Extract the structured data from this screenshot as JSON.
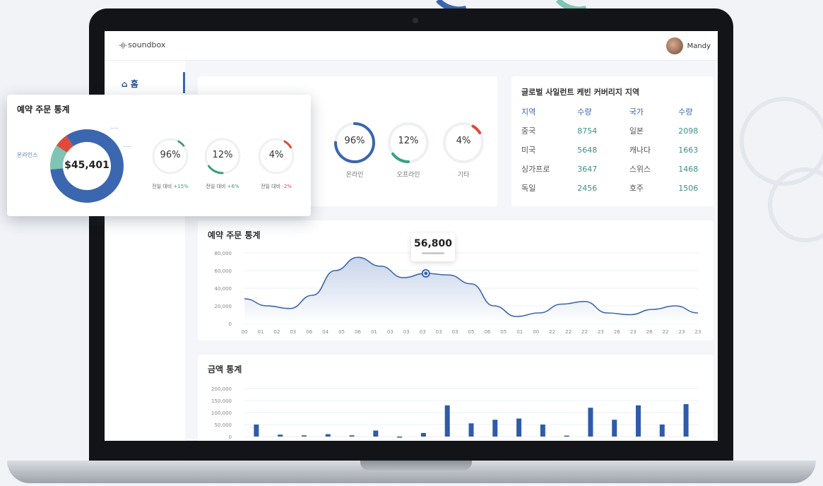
{
  "app": {
    "name": "soundbox",
    "user": "Mandy"
  },
  "sidebar": {
    "home_label": "홈"
  },
  "ring_cards": [
    {
      "value": "96%",
      "label": "온라인",
      "pct": 0.96,
      "color": "#3b65ad"
    },
    {
      "value": "12%",
      "label": "오프라인",
      "pct": 0.12,
      "color": "#3c9f86"
    },
    {
      "value": "4%",
      "label": "기타",
      "pct": 0.04,
      "color": "#e04a3a"
    }
  ],
  "coverage": {
    "title": "글로벌 사일런트 케빈 커버리지 지역",
    "headers": [
      "지역",
      "수량",
      "국가",
      "수량"
    ],
    "rows": [
      [
        "중국",
        "8754",
        "일본",
        "2098"
      ],
      [
        "미국",
        "5648",
        "캐나다",
        "1663"
      ],
      [
        "싱가프로",
        "3647",
        "스위스",
        "1468"
      ],
      [
        "독일",
        "2456",
        "호주",
        "1506"
      ]
    ]
  },
  "popup": {
    "title": "예약 주문 통계",
    "total": "$45,401",
    "left_label": "온라인스",
    "rings": [
      {
        "value": "96%",
        "caption_prefix": "전일 대비",
        "delta": "+15%",
        "pct": 0.96,
        "color": "#3c9f76"
      },
      {
        "value": "12%",
        "caption_prefix": "전일 대비",
        "delta": "+6%",
        "pct": 0.12,
        "color": "#3c9f76"
      },
      {
        "value": "4%",
        "caption_prefix": "전일 대비",
        "delta": "-2%",
        "pct": 0.04,
        "color": "#e04a3a"
      }
    ],
    "donut": [
      0.83,
      0.11,
      0.06
    ],
    "donut_colors": [
      "#3b67b0",
      "#7fc4b4",
      "#e04a3a"
    ]
  },
  "chart_data": [
    {
      "type": "area",
      "title": "예약 주문 통계",
      "yticks": [
        "80,000",
        "60,000",
        "40,000",
        "20,000",
        "0"
      ],
      "ylim": [
        0,
        80000
      ],
      "x": [
        "00",
        "01",
        "02",
        "03",
        "06",
        "04",
        "05",
        "06",
        "01",
        "03",
        "03",
        "03",
        "03",
        "03",
        "05",
        "06",
        "05",
        "01",
        "00",
        "22",
        "22",
        "22",
        "23",
        "26",
        "23",
        "26",
        "22",
        "23",
        "23"
      ],
      "values": [
        28000,
        20000,
        17000,
        32000,
        60000,
        75000,
        65000,
        52000,
        56800,
        55000,
        45000,
        20000,
        8000,
        12000,
        22000,
        25000,
        12000,
        10000,
        16000,
        20000,
        12000
      ],
      "tooltip": "56,800",
      "grid": true,
      "color": "#3b65ad"
    },
    {
      "type": "bar",
      "title": "금액 통계",
      "yticks": [
        "200,000",
        "150,000",
        "100,000",
        "50,000",
        "0"
      ],
      "ylim": [
        0,
        200000
      ],
      "values": [
        50000,
        8000,
        5000,
        10000,
        5000,
        25000,
        0,
        15000,
        130000,
        55000,
        70000,
        75000,
        50000,
        4000,
        120000,
        70000,
        130000,
        50000,
        135000
      ],
      "grid": true,
      "color": "#2f5ba8"
    }
  ],
  "colors": {
    "accent": "#3b65ad",
    "teal": "#3c9f86",
    "red": "#e04a3a"
  }
}
